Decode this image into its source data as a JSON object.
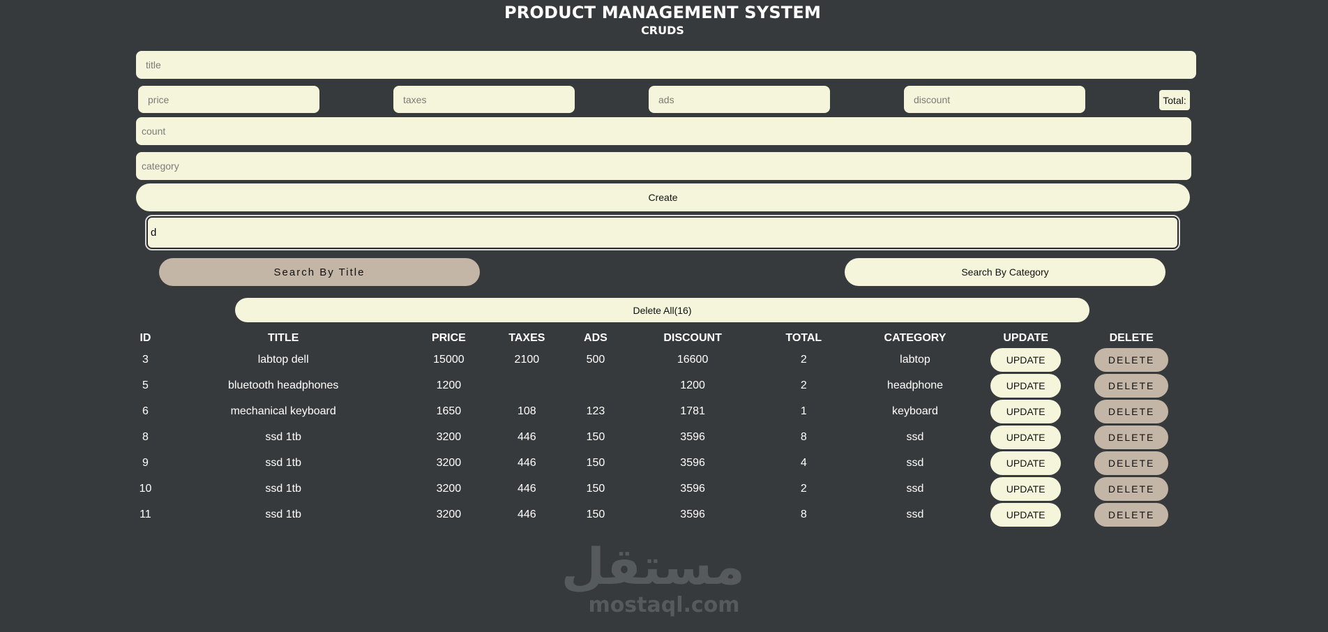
{
  "header": {
    "title": "PRODUCT MANAGEMENT SYSTEM",
    "subtitle": "CRUDS"
  },
  "form": {
    "title_placeholder": "title",
    "price_placeholder": "price",
    "taxes_placeholder": "taxes",
    "ads_placeholder": "ads",
    "discount_placeholder": "discount",
    "total_label": "Total:",
    "count_placeholder": "count",
    "category_placeholder": "category",
    "create_label": "Create"
  },
  "search": {
    "value": "d",
    "by_title_label": "Search By Title",
    "by_category_label": "Search By Category"
  },
  "delete_all_label": "Delete All(16)",
  "table": {
    "headers": [
      "ID",
      "TITLE",
      "PRICE",
      "TAXES",
      "ADS",
      "DISCOUNT",
      "TOTAL",
      "CATEGORY",
      "UPDATE",
      "DELETE"
    ],
    "update_label": "UPDATE",
    "delete_label": "DELETE",
    "rows": [
      {
        "id": "3",
        "title": "labtop dell",
        "price": "15000",
        "taxes": "2100",
        "ads": "500",
        "discount": "16600",
        "total": "2",
        "category": "labtop"
      },
      {
        "id": "5",
        "title": "bluetooth headphones",
        "price": "1200",
        "taxes": "",
        "ads": "",
        "discount": "1200",
        "total": "2",
        "category": "headphone"
      },
      {
        "id": "6",
        "title": "mechanical keyboard",
        "price": "1650",
        "taxes": "108",
        "ads": "123",
        "discount": "1781",
        "total": "1",
        "category": "keyboard"
      },
      {
        "id": "8",
        "title": "ssd 1tb",
        "price": "3200",
        "taxes": "446",
        "ads": "150",
        "discount": "3596",
        "total": "8",
        "category": "ssd"
      },
      {
        "id": "9",
        "title": "ssd 1tb",
        "price": "3200",
        "taxes": "446",
        "ads": "150",
        "discount": "3596",
        "total": "4",
        "category": "ssd"
      },
      {
        "id": "10",
        "title": "ssd 1tb",
        "price": "3200",
        "taxes": "446",
        "ads": "150",
        "discount": "3596",
        "total": "2",
        "category": "ssd"
      },
      {
        "id": "11",
        "title": "ssd 1tb",
        "price": "3200",
        "taxes": "446",
        "ads": "150",
        "discount": "3596",
        "total": "8",
        "category": "ssd"
      }
    ]
  },
  "watermark": {
    "arabic": "مستقل",
    "latin": "mostaql.com"
  }
}
